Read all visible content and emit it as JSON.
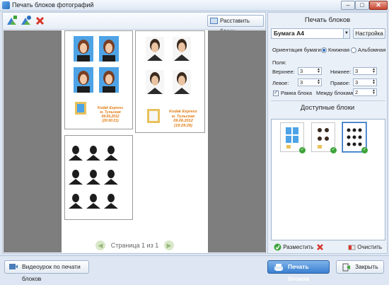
{
  "window": {
    "title": "Печать блоков фотографий",
    "close_label": "✕",
    "minimize_label": "–",
    "maximize_label": "□"
  },
  "toolbar": {
    "arrange_label": "Расставить блоки"
  },
  "blocks": [
    {
      "caption": [
        "Kodak Express",
        "м. Тульская",
        "09.06.2012",
        "(20:00:21)"
      ],
      "caption_color": "#e07a10"
    },
    {
      "caption": [
        "Kodak Express",
        "м. Тульская",
        "09.06.2012",
        "(19:29:26)"
      ],
      "caption_color": "#e07a10"
    }
  ],
  "pager": {
    "text": "Страница 1 из 1"
  },
  "print_blocks": {
    "title": "Печать блоков",
    "paper_value": "Бумага А4",
    "settings_label": "Настройка",
    "orientation_label": "Ориентация бумаги:",
    "orientation_options": [
      "Книжная",
      "Альбомная"
    ],
    "orientation_selected": "Книжная",
    "margins_label": "Поля:",
    "top_label": "Верхнее:",
    "top_value": "3",
    "bottom_label": "Нижнее:",
    "bottom_value": "3",
    "left_label": "Левое:",
    "left_value": "3",
    "right_label": "Правое:",
    "right_value": "3",
    "frame_label": "Рамка блока",
    "frame_checked": true,
    "between_label": "Между блоками:",
    "between_value": "2"
  },
  "available": {
    "title": "Доступные блоки",
    "place_label": "Разместить",
    "clear_label": "Очистить"
  },
  "bottom": {
    "tutorial_label": "Видеоурок по печати блоков",
    "print_label": "Печать блоков",
    "close_label": "Закрыть"
  },
  "colors": {
    "accent": "#2a6fbf",
    "photo_bg_blue": "#4da3e6",
    "check_green": "#3da43a"
  }
}
